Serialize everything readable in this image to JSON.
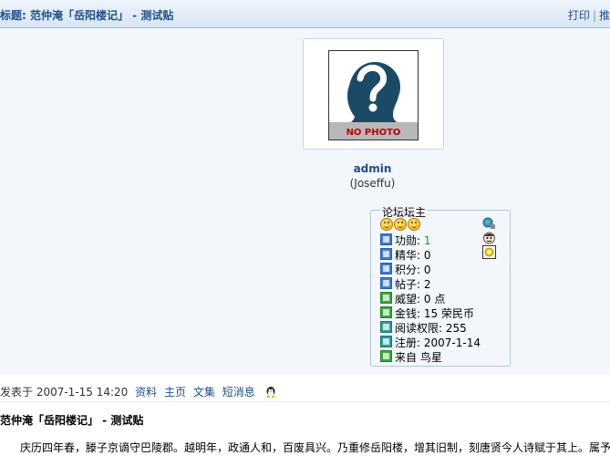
{
  "header": {
    "title": "标题: 范仲淹「岳阳楼记」 - 测试贴",
    "actions": [
      "打印",
      "推"
    ]
  },
  "profile": {
    "avatar_text": "NO PHOTO",
    "username": "admin",
    "nickname": "(Joseffu)",
    "group_title": "论坛坛主",
    "stats": [
      {
        "label": "功勋:",
        "value": "1",
        "icon": "medal-icon"
      },
      {
        "label": "精华:",
        "value": "0",
        "icon": "digest-icon"
      },
      {
        "label": "积分:",
        "value": "0",
        "icon": "credits-icon"
      },
      {
        "label": "帖子:",
        "value": "2",
        "icon": "posts-icon"
      },
      {
        "label": "威望:",
        "value": "0 点",
        "icon": "prestige-icon"
      },
      {
        "label": "金钱:",
        "value": "15 荣民币",
        "icon": "money-icon"
      },
      {
        "label": "阅读权限:",
        "value": "255",
        "icon": "read-permission-icon"
      },
      {
        "label": "注册:",
        "value": "2007-1-14",
        "icon": "register-icon"
      },
      {
        "label": "来自",
        "value": "鸟星",
        "icon": "location-icon"
      }
    ]
  },
  "post": {
    "posted_at": "发表于 2007-1-15 14:20",
    "links": [
      "资料",
      "主页",
      "文集",
      "短消息"
    ],
    "title": "范仲淹「岳阳楼记」 - 测试贴",
    "body": "庆历四年春，滕子京谪守巴陵郡。越明年，政通人和，百废具兴。乃重修岳阳楼，增其旧制，刻唐贤今人诗赋于其上。属予"
  },
  "colors": {
    "link": "#1f4e8c",
    "header_bg": "#d7e5f5",
    "profile_bg": "#f3f7fc",
    "highlight_green": "#18a018"
  }
}
